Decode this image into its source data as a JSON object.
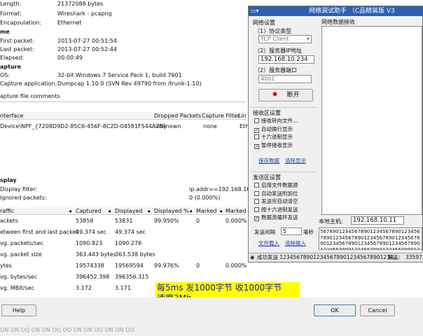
{
  "ws": {
    "top_fields": {
      "length_label": "Length:",
      "length_value": "21372088 bytes",
      "format_label": "Format:",
      "format_value": "Wireshark - pcapng",
      "encap_label": "Encapsulation:",
      "encap_value": "Ethernet"
    },
    "time": {
      "heading": "me",
      "first_label": "First packet:",
      "first_value": "2013-07-27 00:51:54",
      "last_label": "Last packet:",
      "last_value": "2013-07-27 00:52:44",
      "elapsed_label": "Elapsed:",
      "elapsed_value": "00:00:49"
    },
    "capture": {
      "heading": "apture",
      "os_label": "OS:",
      "os_value": "32-bit Windows 7 Service Pack 1, build 7601",
      "app_label": "Capture application:",
      "app_value": "Dumpcap 1.10.0 (SVN Rev 49790 from /trunk-1.10)",
      "comments_label": "apture file comments"
    },
    "interface_table": {
      "headers": [
        "nterface",
        "Dropped Packets",
        "Capture Filter",
        "Lin"
      ],
      "row": [
        "Device\\NPF_{7208D9D2-85C6-456F-8C2D-04581F544A7B}",
        "unknown",
        "none",
        "Eth"
      ]
    },
    "display": {
      "heading": "splay",
      "filter_label": "Display filter:",
      "filter_value": "ip.addr==192.168.10.2",
      "ignored_label": "Ignored packets:",
      "ignored_value": "0 (0.000%)"
    },
    "traffic": {
      "headers": [
        "raffic",
        "Captured",
        "Displayed",
        "Displayed %",
        "Marked",
        "Marked"
      ],
      "rows": [
        [
          "ackets",
          "53858",
          "53831",
          "99.950%",
          "0",
          "0.000%"
        ],
        [
          "etween first and last packet",
          "49.374 sec",
          "49.374 sec",
          "",
          "",
          ""
        ],
        [
          "vg. packets/sec",
          "1090.823",
          "1090.276",
          "",
          "",
          ""
        ],
        [
          "vg. packet size",
          "363.443 bytes",
          "363.538 bytes",
          "",
          "",
          ""
        ],
        [
          "ytes",
          "19574338",
          "19569594",
          "99.976%",
          "0",
          "0.000%"
        ],
        [
          "vg. bytes/sec",
          "396452.398",
          "396356.315",
          "",
          "",
          ""
        ],
        [
          "vg. MBit/sec",
          "3.172",
          "3.171",
          "",
          "",
          ""
        ]
      ]
    },
    "help_button": "Help",
    "ok_button": "OK",
    "cancel_button": "Cancel",
    "bottom_strip": "ON ON OO ON ON OO OO ON ON OO ON ON OO"
  },
  "annotation": {
    "line1": "每5ms 发1000字节 收1000字节",
    "line2": "速度3Mb",
    "background": "#ffff00",
    "color": "#2020a0"
  },
  "assistant": {
    "title": "网络调试助手  （C品精装版 V3",
    "settings_heading": "网络设置",
    "protocol_label": "（1）协议类型",
    "protocol_value": "TCP Client",
    "server_ip_label": "（2）服务器IP地址",
    "server_ip_value": "192.168.10.234",
    "server_port_label": "（2）服务器端口",
    "server_port_value": "4001",
    "disconnect_button": "断开",
    "recv_settings_heading": "接收区设置",
    "recv_options": [
      {
        "label": "接收转向文件...",
        "checked": false
      },
      {
        "label": "自动换行显示",
        "checked": true
      },
      {
        "label": "十六进制显示",
        "checked": false
      },
      {
        "label": "暂停接收显示",
        "checked": true
      }
    ],
    "recv_save": "保存数据",
    "recv_clear": "清除显示",
    "send_settings_heading": "发送区设置",
    "send_options": [
      {
        "label": "启用文件数据源",
        "checked": false
      },
      {
        "label": "自动发送附加位",
        "checked": false
      },
      {
        "label": "发送完自动清空",
        "checked": false
      },
      {
        "label": "按十六进制发送",
        "checked": false
      },
      {
        "label": "数据流循环发送",
        "checked": true
      }
    ],
    "interval_label": "发送间隔",
    "interval_value": "5",
    "interval_unit": "毫秒",
    "file_load": "文件载入",
    "clear_input": "清除输入",
    "recv_area_label": "网络数据接收",
    "local_host_label": "本地主机:",
    "local_host_value": "192.168.10.11",
    "send_data": "5678901234567890123456789012345678901234567890123456789012345678901234567890123456789012345678901234567890123456789012345678901234567890123456789012345678901234567890123456789012345678901234567890123456789012345678901234567890",
    "status_text": "成功发送  1234567890123456789012345678901234...",
    "status_send_label": "发送：",
    "status_send_value": "33597"
  }
}
